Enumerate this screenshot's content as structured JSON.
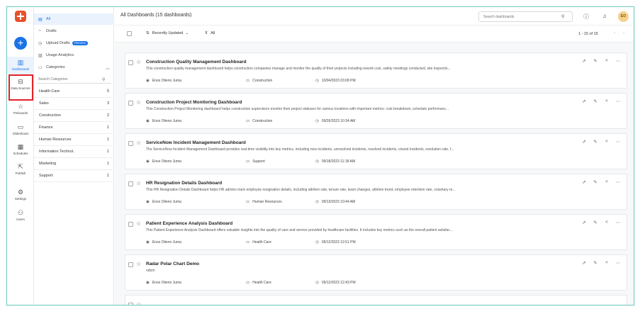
{
  "rail": {
    "items": [
      {
        "label": "Dashboards",
        "icon": "bar-chart-icon",
        "glyph": "▥"
      },
      {
        "label": "Data Sources",
        "icon": "data-sources-icon",
        "glyph": "⊟"
      },
      {
        "label": "Pinboards",
        "icon": "pin-icon",
        "glyph": "☆"
      },
      {
        "label": "Slideshows",
        "icon": "slideshow-icon",
        "glyph": "▭"
      },
      {
        "label": "Schedules",
        "icon": "calendar-icon",
        "glyph": "▦"
      },
      {
        "label": "Publish",
        "icon": "publish-icon",
        "glyph": "⇱"
      },
      {
        "label": "Settings",
        "icon": "gear-icon",
        "glyph": "⚙"
      },
      {
        "label": "Users",
        "icon": "users-icon",
        "glyph": "⚇"
      }
    ]
  },
  "nav": {
    "all": "All",
    "drafts": "Drafts",
    "upload_drafts": "Upload Drafts",
    "preview_badge": "PREVIEW",
    "usage_analytics": "Usage Analytics",
    "categories": "Categories",
    "search_categories_placeholder": "Search Categories"
  },
  "categories": [
    {
      "name": "Health Care",
      "count": "5"
    },
    {
      "name": "Sales",
      "count": "3"
    },
    {
      "name": "Construction",
      "count": "2"
    },
    {
      "name": "Finance",
      "count": "1"
    },
    {
      "name": "Human Resources",
      "count": "1"
    },
    {
      "name": "Information Technol..",
      "count": "1"
    },
    {
      "name": "Marketing",
      "count": "1"
    },
    {
      "name": "Support",
      "count": "1"
    }
  ],
  "header": {
    "title": "All Dashboards (15 dashboards)",
    "search_placeholder": "Search dashboards",
    "avatar_initials": "EO"
  },
  "toolbar": {
    "sort_label": "Recently Updated",
    "filter_label": "All",
    "pager_text": "1 - 15 of 15"
  },
  "dashboards": [
    {
      "title": "Construction Quality Management Dashboard",
      "description": "This construction quality management dashboard helps construction companies manage and monitor the quality of their projects including rework cost, safety meetings conducted, site inspectio...",
      "owner": "Enos Otieno Juma",
      "category": "Construction",
      "updated": "10/04/2023 03:08 PM"
    },
    {
      "title": "Construction Project Monitoring Dashboard",
      "description": "This Construction Project Monitoring dashboard helps construction supervisors monitor their project statuses for various locations with important metrics: cost breakdown, schedule performanc...",
      "owner": "Enos Otieno Juma",
      "category": "Construction",
      "updated": "09/26/2023 10:34 AM"
    },
    {
      "title": "ServiceNow Incident Management Dashboard",
      "description": "The ServiceNow Incident Management Dashboard provides real-time visibility into key metrics, including new incidents, unresolved incidents, resolved incidents, closed incidents, resolution rate, f...",
      "owner": "Enos Otieno Juma",
      "category": "Support",
      "updated": "09/18/2023 11:18 AM"
    },
    {
      "title": "HR Resignation Details Dashboard",
      "description": "This HR Resignation Details Dashboard helps HR admins track employee resignation details, including attrition rate, tenure rate, team changes, attrition trend, employee retention rate, voluntary re...",
      "owner": "Enos Otieno Juma",
      "category": "Human Resources",
      "updated": "09/13/2023 10:44 AM"
    },
    {
      "title": "Patient Experience Analysis Dashboard",
      "description": "This Patient Experience Analysis Dashboard offers valuable insights into the quality of care and service provided by healthcare facilities. It includes key metrics such as the overall patient satisfac...",
      "owner": "Enos Otieno Juma",
      "category": "Health Care",
      "updated": "09/12/2023 12:51 PM"
    },
    {
      "title": "Radar Polar Chart Demo",
      "description": "ndom",
      "owner": "Enos Otieno Juma",
      "category": "Health Care",
      "updated": "09/12/2023 12:43 PM"
    }
  ],
  "colors": {
    "accent": "#1a73e8",
    "highlight": "#e0242b",
    "brand": "#e8502a"
  }
}
